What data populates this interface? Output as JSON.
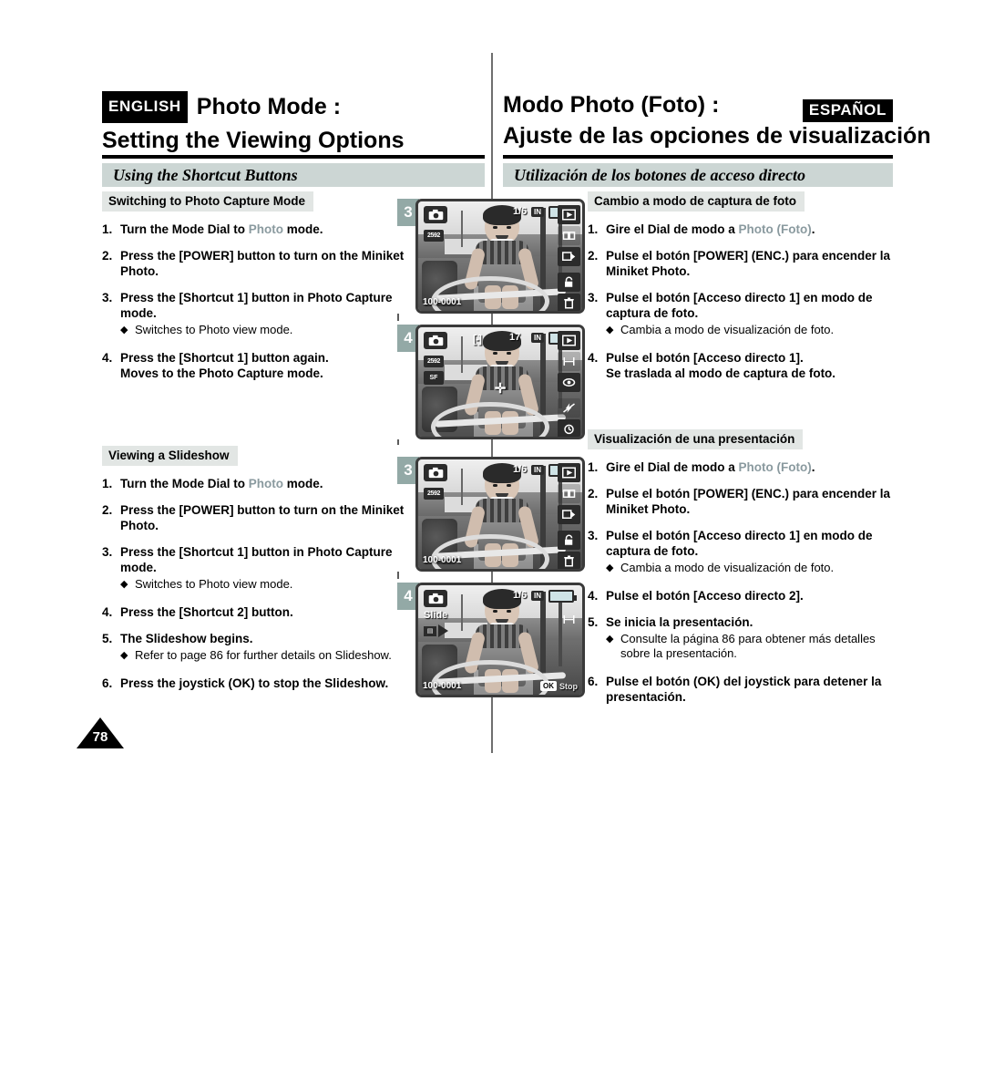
{
  "header": {
    "left_tag": "ENGLISH",
    "right_tag": "ESPAÑOL",
    "left_line1": "Photo Mode :",
    "left_line2": "Setting the Viewing Options",
    "right_line1": "Modo Photo (Foto) :",
    "right_line2": "Ajuste de las opciones de visualización"
  },
  "bands": {
    "left": "Using the Shortcut Buttons",
    "right": "Utilización de los botones de acceso directo"
  },
  "page_number": "78",
  "left_column": {
    "section1": {
      "heading": "Switching to Photo Capture Mode",
      "steps": [
        {
          "num": "1.",
          "pre": "Turn the Mode Dial to ",
          "accent": "Photo",
          "post": " mode."
        },
        {
          "num": "2.",
          "text": "Press the [POWER] button to turn on the Miniket Photo."
        },
        {
          "num": "3.",
          "text": "Press the [Shortcut 1] button in Photo Capture mode.",
          "bullets": [
            "Switches to Photo view mode."
          ]
        },
        {
          "num": "4.",
          "text": "Press the [Shortcut 1] button again.",
          "line2": "Moves to the Photo Capture mode."
        }
      ]
    },
    "section2": {
      "heading": "Viewing a Slideshow",
      "steps": [
        {
          "num": "1.",
          "pre": "Turn the Mode Dial to ",
          "accent": "Photo",
          "post": " mode."
        },
        {
          "num": "2.",
          "text": "Press the [POWER] button to turn on the Miniket Photo."
        },
        {
          "num": "3.",
          "text": "Press the [Shortcut 1] button in Photo Capture mode.",
          "bullets": [
            "Switches to Photo view mode."
          ]
        },
        {
          "num": "4.",
          "text": "Press the [Shortcut 2] button."
        },
        {
          "num": "5.",
          "text": "The Slideshow begins.",
          "bullets": [
            "Refer to page 86 for further details on Slideshow."
          ]
        },
        {
          "num": "6.",
          "text": "Press the joystick (OK) to stop the Slideshow."
        }
      ]
    }
  },
  "right_column": {
    "section1": {
      "heading": "Cambio a modo de captura de foto",
      "steps": [
        {
          "num": "1.",
          "pre": "Gire el Dial de modo a ",
          "accent": "Photo (Foto)",
          "post": "."
        },
        {
          "num": "2.",
          "text": "Pulse el botón [POWER] (ENC.) para encender la Miniket Photo."
        },
        {
          "num": "3.",
          "text": "Pulse el botón [Acceso directo 1] en modo de captura de foto.",
          "bullets": [
            "Cambia a modo de visualización de foto."
          ]
        },
        {
          "num": "4.",
          "text": "Pulse el botón [Acceso directo 1].",
          "line2": "Se traslada al modo de captura de foto."
        }
      ]
    },
    "section2": {
      "heading": "Visualización de una presentación",
      "steps": [
        {
          "num": "1.",
          "pre": "Gire el Dial de modo a ",
          "accent": "Photo (Foto)",
          "post": "."
        },
        {
          "num": "2.",
          "text": "Pulse el botón [POWER] (ENC.) para encender la Miniket Photo."
        },
        {
          "num": "3.",
          "text": "Pulse el botón [Acceso directo 1] en modo de captura de foto.",
          "bullets": [
            "Cambia a modo de visualización de foto."
          ]
        },
        {
          "num": "4.",
          "text": "Pulse el botón [Acceso directo 2]."
        },
        {
          "num": "5.",
          "text": "Se inicia la presentación.",
          "bullets": [
            "Consulte la página 86 para obtener más detalles sobre la presentación."
          ]
        },
        {
          "num": "6.",
          "text": "Pulse el botón (OK) del joystick para detener la presentación."
        }
      ]
    }
  },
  "figures": [
    {
      "badge": "3",
      "mode": "photo-view",
      "counter": "1/6",
      "memory": "IN",
      "resolution": "2592",
      "filename": "100-0001",
      "rail_icons": [
        "play-icon",
        "multi-view-icon",
        "unlock-icon",
        "trash-icon"
      ]
    },
    {
      "badge": "4",
      "mode": "photo-capture",
      "counter": "17",
      "memory": "IN",
      "resolution": "2592",
      "quality": "SF",
      "focus": "[-]",
      "rail_icons": [
        "play-icon",
        "macro-icon",
        "redeye-icon",
        "flash-off-icon",
        "self-timer-icon"
      ]
    },
    {
      "badge": "3",
      "mode": "photo-view",
      "counter": "1/6",
      "memory": "IN",
      "resolution": "2592",
      "filename": "100-0001",
      "rail_icons": [
        "play-icon",
        "multi-view-icon",
        "unlock-icon",
        "trash-icon"
      ]
    },
    {
      "badge": "4",
      "mode": "slideshow",
      "counter": "1/6",
      "memory": "IN",
      "slide_label": "Slide",
      "filename": "100-0001",
      "ok_label": "OK",
      "stop_label": "Stop",
      "rail_icons": [
        "macro-icon"
      ]
    }
  ],
  "colors": {
    "band": "#ccd6d4",
    "subhead": "#e2e6e4",
    "badge": "#93a9a6",
    "accent": "#8a9a9f"
  }
}
